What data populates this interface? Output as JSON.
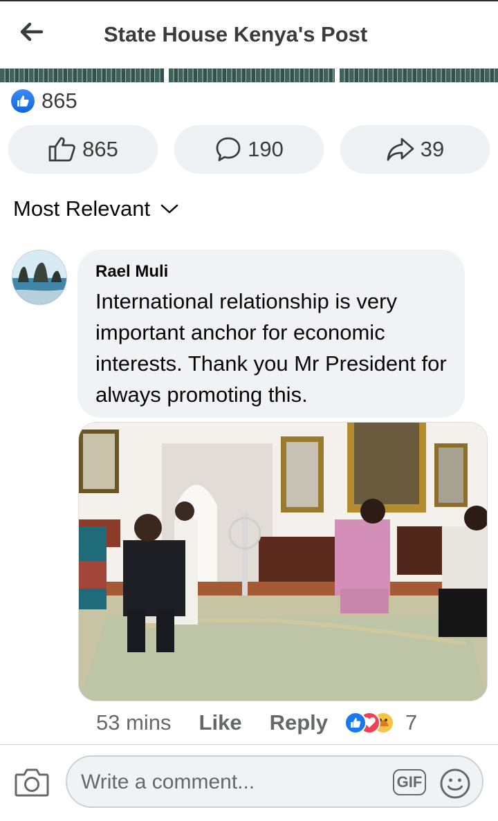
{
  "header": {
    "title": "State House Kenya's Post",
    "back_icon": "arrow-left-icon"
  },
  "reactions_summary": {
    "count": "865",
    "icon": "like-icon",
    "color": "#1877f2"
  },
  "actions": {
    "like": {
      "count": "865",
      "icon": "thumbs-up-icon"
    },
    "comment": {
      "count": "190",
      "icon": "comment-icon"
    },
    "share": {
      "count": "39",
      "icon": "share-icon"
    }
  },
  "sort": {
    "label": "Most Relevant",
    "icon": "chevron-down-icon"
  },
  "comment": {
    "author": "Rael Muli",
    "text": "International relationship is very important anchor for economic interests. Thank you Mr President for always promoting this.",
    "time": "53 mins",
    "like_label": "Like",
    "reply_label": "Reply",
    "reaction_count": "7",
    "reaction_icons": [
      "like-icon",
      "love-icon",
      "care-icon"
    ]
  },
  "composer": {
    "placeholder": "Write a comment...",
    "gif_label": "GIF",
    "camera_icon": "camera-icon",
    "emoji_icon": "smiley-icon"
  }
}
